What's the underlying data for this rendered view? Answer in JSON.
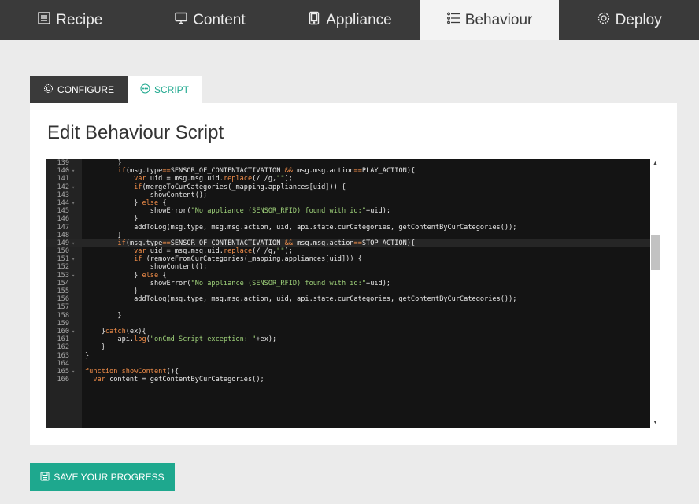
{
  "nav": {
    "tabs": [
      {
        "label": "Recipe",
        "icon": "document-icon"
      },
      {
        "label": "Content",
        "icon": "monitor-icon"
      },
      {
        "label": "Appliance",
        "icon": "tablet-icon"
      },
      {
        "label": "Behaviour",
        "icon": "list-icon"
      },
      {
        "label": "Deploy",
        "icon": "gear-icon"
      }
    ],
    "active": "Behaviour"
  },
  "subtabs": {
    "configure": "CONFIGURE",
    "script": "SCRIPT"
  },
  "panel": {
    "title": "Edit Behaviour Script"
  },
  "editor": {
    "code_lines": [
      {
        "n": "139",
        "fold": false,
        "text": "        }"
      },
      {
        "n": "140",
        "fold": true,
        "text": "        if(msg.type==SENSOR_OF_CONTENTACTIVATION && msg.msg.action==PLAY_ACTION){"
      },
      {
        "n": "141",
        "fold": false,
        "text": "            var uid = msg.msg.uid.replace(/ /g,\"\");"
      },
      {
        "n": "142",
        "fold": true,
        "text": "            if(mergeToCurCategories(_mapping.appliances[uid])) {"
      },
      {
        "n": "143",
        "fold": false,
        "text": "                showContent();"
      },
      {
        "n": "144",
        "fold": true,
        "text": "            } else {"
      },
      {
        "n": "145",
        "fold": false,
        "text": "                showError(\"No appliance (SENSOR_RFID) found with id:\"+uid);"
      },
      {
        "n": "146",
        "fold": false,
        "text": "            }"
      },
      {
        "n": "147",
        "fold": false,
        "text": "            addToLog(msg.type, msg.msg.action, uid, api.state.curCategories, getContentByCurCategories());"
      },
      {
        "n": "148",
        "fold": false,
        "text": "        }"
      },
      {
        "n": "149",
        "fold": true,
        "text": "        if(msg.type==SENSOR_OF_CONTENTACTIVATION && msg.msg.action==STOP_ACTION){"
      },
      {
        "n": "150",
        "fold": false,
        "text": "            var uid = msg.msg.uid.replace(/ /g,\"\");"
      },
      {
        "n": "151",
        "fold": true,
        "text": "            if (removeFromCurCategories(_mapping.appliances[uid])) {"
      },
      {
        "n": "152",
        "fold": false,
        "text": "                showContent();"
      },
      {
        "n": "153",
        "fold": true,
        "text": "            } else {"
      },
      {
        "n": "154",
        "fold": false,
        "text": "                showError(\"No appliance (SENSOR_RFID) found with id:\"+uid);"
      },
      {
        "n": "155",
        "fold": false,
        "text": "            }"
      },
      {
        "n": "156",
        "fold": false,
        "text": "            addToLog(msg.type, msg.msg.action, uid, api.state.curCategories, getContentByCurCategories());"
      },
      {
        "n": "157",
        "fold": false,
        "text": ""
      },
      {
        "n": "158",
        "fold": false,
        "text": "        }"
      },
      {
        "n": "159",
        "fold": false,
        "text": ""
      },
      {
        "n": "160",
        "fold": true,
        "text": "    }catch(ex){"
      },
      {
        "n": "161",
        "fold": false,
        "text": "        api.log(\"onCmd Script exception: \"+ex);"
      },
      {
        "n": "162",
        "fold": false,
        "text": "    }"
      },
      {
        "n": "163",
        "fold": false,
        "text": "}"
      },
      {
        "n": "164",
        "fold": false,
        "text": ""
      },
      {
        "n": "165",
        "fold": true,
        "text": "function showContent(){"
      },
      {
        "n": "166",
        "fold": false,
        "text": "  var content = getContentByCurCategories();"
      }
    ],
    "highlighted_line": "149"
  },
  "save_button": {
    "label": "SAVE YOUR PROGRESS"
  },
  "colors": {
    "accent": "#1ea88e",
    "nav_bg": "#3a3a3a",
    "editor_bg": "#141414"
  }
}
